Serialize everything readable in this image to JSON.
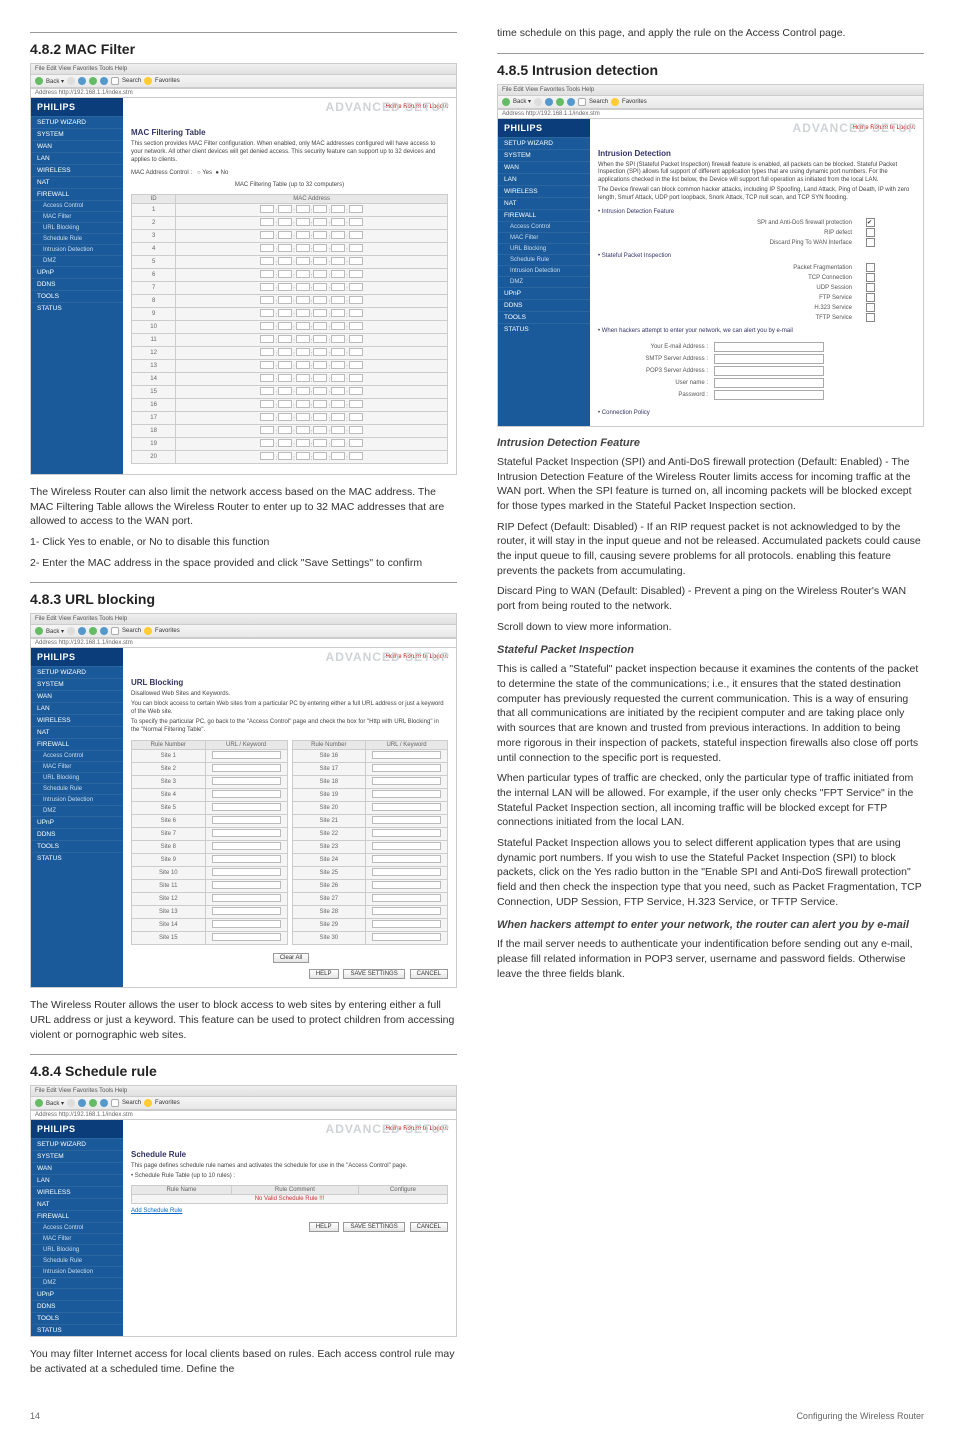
{
  "page_number": "14",
  "footer_right": "Configuring the Wireless Router",
  "toolbar_menu": "File  Edit  View  Favorites  Tools  Help",
  "toolbar_addr": "Address  http://192.168.1.1/index.stm",
  "philips": "PHILIPS",
  "adv_setup": "ADVANCED SETUP",
  "home_logout": "Home  Return to  Logout",
  "sidebar_main": [
    "SETUP WIZARD",
    "SYSTEM",
    "WAN",
    "LAN",
    "WIRELESS",
    "NAT",
    "FIREWALL"
  ],
  "sidebar_fw_sub": [
    "Access Control",
    "MAC Filter",
    "URL Blocking",
    "Schedule Rule",
    "Intrusion Detection",
    "DMZ"
  ],
  "sidebar_tail": [
    "UPnP",
    "DDNS",
    "TOOLS",
    "STATUS"
  ],
  "btn_help": "HELP",
  "btn_save": "SAVE SETTINGS",
  "btn_cancel": "CANCEL",
  "btn_clear": "Clear All",
  "s482": {
    "heading": "4.8.2  MAC Filter",
    "title": "MAC Filtering Table",
    "desc": "This section provides MAC Filter configuration. When enabled, only MAC addresses configured will have access to your network. All other client devices will get denied access. This security feature can support up to 32 devices and applies to clients.",
    "ctrl_lbl": "MAC Address Control :",
    "radio_yes": "Yes",
    "radio_no": "No",
    "tbl_caption": "MAC Filtering Table (up to 32 computers)",
    "col_id": "ID",
    "col_mac": "MAC Address",
    "row_count": 20,
    "para1": "The Wireless Router can also limit the network access based on the MAC address. The MAC Filtering Table allows the Wireless Router to enter up to 32 MAC addresses that are  allowed to access to the WAN port.",
    "para2": "1- Click Yes to enable, or No to disable this function",
    "para3": "2- Enter the MAC address in the space provided and click \"Save Settings\" to confirm"
  },
  "s483": {
    "heading": "4.8.3  URL blocking",
    "title": "URL Blocking",
    "sub": "Disallowed Web Sites and Keywords.",
    "desc1": "You can block access to certain Web sites from a particular PC by entering either a full URL address or just a keyword of the Web site.",
    "desc2": "To specify the particular PC, go back to the \"Access Control\" page and check the box for \"Http with URL Blocking\" in the \"Normal Filtering Table\".",
    "col_rule": "Rule Number",
    "col_key": "URL / Keyword",
    "rows_left": [
      "Site 1",
      "Site 2",
      "Site 3",
      "Site 4",
      "Site 5",
      "Site 6",
      "Site 7",
      "Site 8",
      "Site 9",
      "Site 10",
      "Site 11",
      "Site 12",
      "Site 13",
      "Site 14",
      "Site 15"
    ],
    "rows_right": [
      "Site 16",
      "Site 17",
      "Site 18",
      "Site 19",
      "Site 20",
      "Site 21",
      "Site 22",
      "Site 23",
      "Site 24",
      "Site 25",
      "Site 26",
      "Site 27",
      "Site 28",
      "Site 29",
      "Site 30"
    ],
    "para": "The Wireless Router allows the user to block access to web sites by entering either a full URL address or just a keyword. This feature can be used to protect children from accessing violent or pornographic web sites."
  },
  "s484": {
    "heading": "4.8.4  Schedule rule",
    "title": "Schedule Rule",
    "desc": "This page defines schedule rule names and activates the schedule for use in the \"Access Control\" page.",
    "sub": "• Schedule Rule Table (up to 10 rules) :",
    "col_name": "Rule Name",
    "col_comment": "Rule Comment",
    "col_conf": "Configure",
    "no_rule": "No Valid Schedule Rule !!!",
    "add_link": "Add Schedule Rule",
    "para": "You may filter Internet access for local clients based on rules. Each access control rule may be activated at a scheduled time. Define the"
  },
  "s485": {
    "heading": "4.8.5  Intrusion detection",
    "pre": "time schedule on this page, and apply the rule on the Access Control page.",
    "title": "Intrusion Detection",
    "desc1": "When the SPI (Stateful Packet Inspection) firewall feature is enabled, all packets can be blocked. Stateful Packet Inspection (SPI) allows full support of different application types that are using dynamic port numbers. For the applications checked in the list below, the Device will support full operation as initiated from the local LAN.",
    "desc2": "The Device firewall can block common hacker attacks, including IP Spoofing, Land Attack, Ping of Death, IP with zero length, Smurf Attack, UDP port loopback, Snork Attack, TCP null scan, and TCP SYN flooding.",
    "sect_idf": "• Intrusion Detection Feature",
    "idf_rows": [
      [
        "SPI and Anti-DoS firewall protection",
        true
      ],
      [
        "RIP defect",
        false
      ],
      [
        "Discard Ping To WAN Interface",
        false
      ]
    ],
    "sect_spi": "• Stateful Packet Inspection",
    "spi_rows": [
      [
        "Packet Fragmentation",
        false
      ],
      [
        "TCP Connection",
        false
      ],
      [
        "UDP Session",
        false
      ],
      [
        "FTP Service",
        false
      ],
      [
        "H.323 Service",
        false
      ],
      [
        "TFTP Service",
        false
      ]
    ],
    "sect_mail": "• When hackers attempt to enter your network, we can alert you by e-mail",
    "mail_fields": [
      "Your E-mail Address :",
      "SMTP Server Address :",
      "POP3 Server Address :",
      "User name :",
      "Password :"
    ],
    "sect_conn": "• Connection Policy",
    "h_idf": "Intrusion Detection Feature",
    "p_idf": "Stateful Packet Inspection (SPI) and Anti-DoS firewall protection (Default: Enabled) - The Intrusion Detection Feature of the Wireless Router limits access for incoming traffic at the WAN port. When the SPI feature is turned on, all incoming packets will be blocked except for those types marked in the Stateful Packet Inspection section.",
    "p_rip": "RIP Defect (Default: Disabled) - If an RIP request packet is not acknowledged to by the router, it will stay in the input queue and not be released. Accumulated packets could cause the input queue to fill, causing severe problems for all protocols. enabling this feature prevents the packets from accumulating.",
    "p_ping": "Discard Ping to WAN (Default: Disabled) - Prevent a ping on the Wireless Router's WAN port from being routed to the network.",
    "p_scroll": "Scroll down to view more information.",
    "h_spi": "Stateful Packet Inspection",
    "p_spi1": "This is called a \"Stateful\" packet inspection because it examines the contents of the packet to determine the state of the communications; i.e., it ensures that the stated destination computer has previously requested the current communication. This is a way of ensuring that all communications are initiated by the recipient computer and are taking place only with sources that are known and trusted from previous interactions. In addition to being more rigorous in their inspection of packets, stateful inspection firewalls also close off ports until connection to the specific port is requested.",
    "p_spi2": "When particular types of traffic are checked, only the particular type of traffic initiated from the internal LAN will be allowed. For example, if the user only checks \"FPT Service\" in the Stateful Packet Inspection section, all incoming traffic will be blocked except for FTP connections initiated from the local LAN.",
    "p_spi3": "Stateful Packet Inspection allows you to select different application types that are using dynamic port numbers. If you wish to use the Stateful Packet Inspection (SPI) to block packets, click on the Yes radio button in the \"Enable SPI and Anti-DoS firewall protection\" field and then check the inspection type that you need, such as Packet Fragmentation, TCP Connection, UDP Session, FTP Service, H.323 Service, or TFTP Service.",
    "h_mail": "When hackers attempt to enter your network, the router can alert you by e-mail",
    "p_mail": "If the mail server needs to authenticate your indentification before sending out any e-mail, please fill related information in POP3 server, username and password fields. Otherwise leave the three fields blank."
  }
}
